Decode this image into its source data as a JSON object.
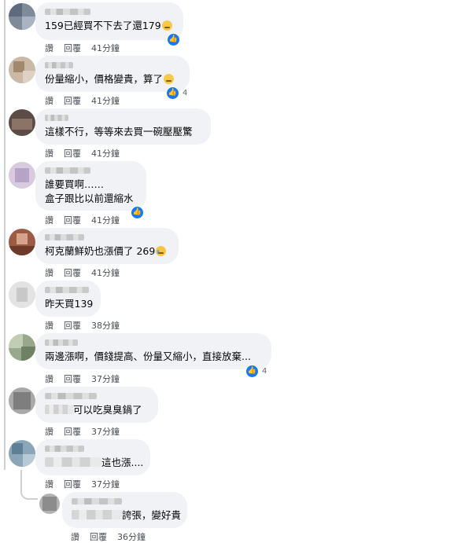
{
  "comments": [
    {
      "text": "159已經買不下去了還179",
      "emoji": "sweat-smile-emoji",
      "like_count": "",
      "actions": {
        "like": "讚",
        "reply": "回覆",
        "time": "41分鐘"
      }
    },
    {
      "text": "份量縮小，價格變貴，算了",
      "emoji": "sweat-smile-emoji",
      "like_count": "4",
      "actions": {
        "like": "讚",
        "reply": "回覆",
        "time": "41分鐘"
      }
    },
    {
      "text": "這樣不行，等等來去買一碗壓壓驚",
      "actions": {
        "like": "讚",
        "reply": "回覆",
        "time": "41分鐘"
      }
    },
    {
      "line1": "誰要買啊……",
      "line2": "盒子跟比以前還縮水",
      "like_count": "",
      "actions": {
        "like": "讚",
        "reply": "回覆",
        "time": "41分鐘"
      }
    },
    {
      "text": "柯克蘭鮮奶也漲價了 269",
      "emoji": "crying-emoji",
      "actions": {
        "like": "讚",
        "reply": "回覆",
        "time": "41分鐘"
      }
    },
    {
      "text": "昨天買139",
      "actions": {
        "like": "讚",
        "reply": "回覆",
        "time": "38分鐘"
      }
    },
    {
      "text": "兩邊漲啊，價錢提高、份量又縮小，直接放棄...",
      "like_count": "4",
      "actions": {
        "like": "讚",
        "reply": "回覆",
        "time": "37分鐘"
      }
    },
    {
      "text": "可以吃臭臭鍋了",
      "actions": {
        "like": "讚",
        "reply": "回覆",
        "time": "37分鐘"
      }
    },
    {
      "text": "這也漲....",
      "actions": {
        "like": "讚",
        "reply": "回覆",
        "time": "37分鐘"
      }
    },
    {
      "text": "誇張，變好貴",
      "actions": {
        "like": "讚",
        "reply": "回覆",
        "time": "36分鐘"
      }
    }
  ],
  "colors": {
    "like_blue": "#1877f2",
    "bubble": "#f0f2f5",
    "meta": "#65676b"
  }
}
